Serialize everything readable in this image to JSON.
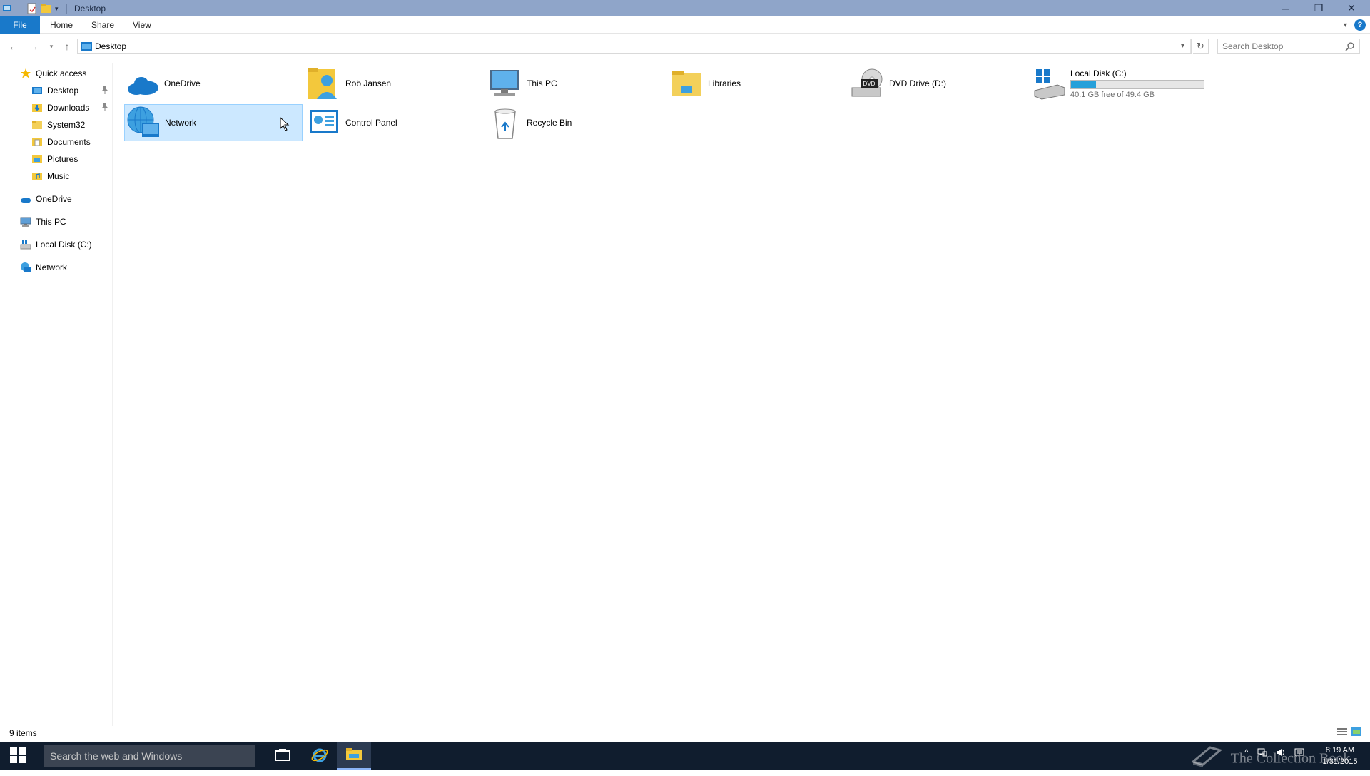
{
  "window": {
    "title": "Desktop",
    "controls": {
      "minimize": "─",
      "maximize": "❐",
      "close": "✕"
    }
  },
  "ribbon": {
    "tabs": [
      "File",
      "Home",
      "Share",
      "View"
    ],
    "help": "?"
  },
  "address": {
    "path": "Desktop",
    "search_placeholder": "Search Desktop"
  },
  "nav_pane": {
    "quick_access": {
      "label": "Quick access",
      "items": [
        {
          "label": "Desktop",
          "pinned": true
        },
        {
          "label": "Downloads",
          "pinned": true
        },
        {
          "label": "System32",
          "pinned": false
        },
        {
          "label": "Documents",
          "pinned": false
        },
        {
          "label": "Pictures",
          "pinned": false
        },
        {
          "label": "Music",
          "pinned": false
        }
      ]
    },
    "roots": [
      "OneDrive",
      "This PC",
      "Local Disk (C:)",
      "Network"
    ]
  },
  "content": {
    "items": [
      {
        "label": "OneDrive",
        "icon": "onedrive-icon"
      },
      {
        "label": "Rob Jansen",
        "icon": "user-folder-icon"
      },
      {
        "label": "This PC",
        "icon": "this-pc-icon"
      },
      {
        "label": "Libraries",
        "icon": "libraries-icon"
      },
      {
        "label": "DVD Drive (D:)",
        "icon": "dvd-drive-icon"
      },
      {
        "label": "Local Disk (C:)",
        "icon": "local-disk-icon",
        "free_text": "40.1 GB free of 49.4 GB",
        "used_fraction": 0.19
      },
      {
        "label": "Network",
        "icon": "network-icon",
        "selected": true
      },
      {
        "label": "Control Panel",
        "icon": "control-panel-icon"
      },
      {
        "label": "Recycle Bin",
        "icon": "recycle-bin-icon"
      }
    ]
  },
  "status": {
    "item_count": "9 items"
  },
  "taskbar": {
    "search_placeholder": "Search the web and Windows",
    "watermark": "The Collection Book",
    "time": "8:19 AM",
    "date": "1/31/2015"
  },
  "colors": {
    "accent": "#1979ca",
    "titlebar": "#8fa5c9",
    "selection": "#cce8ff",
    "taskbar": "#101d2e",
    "drive_fill": "#26a0da"
  }
}
